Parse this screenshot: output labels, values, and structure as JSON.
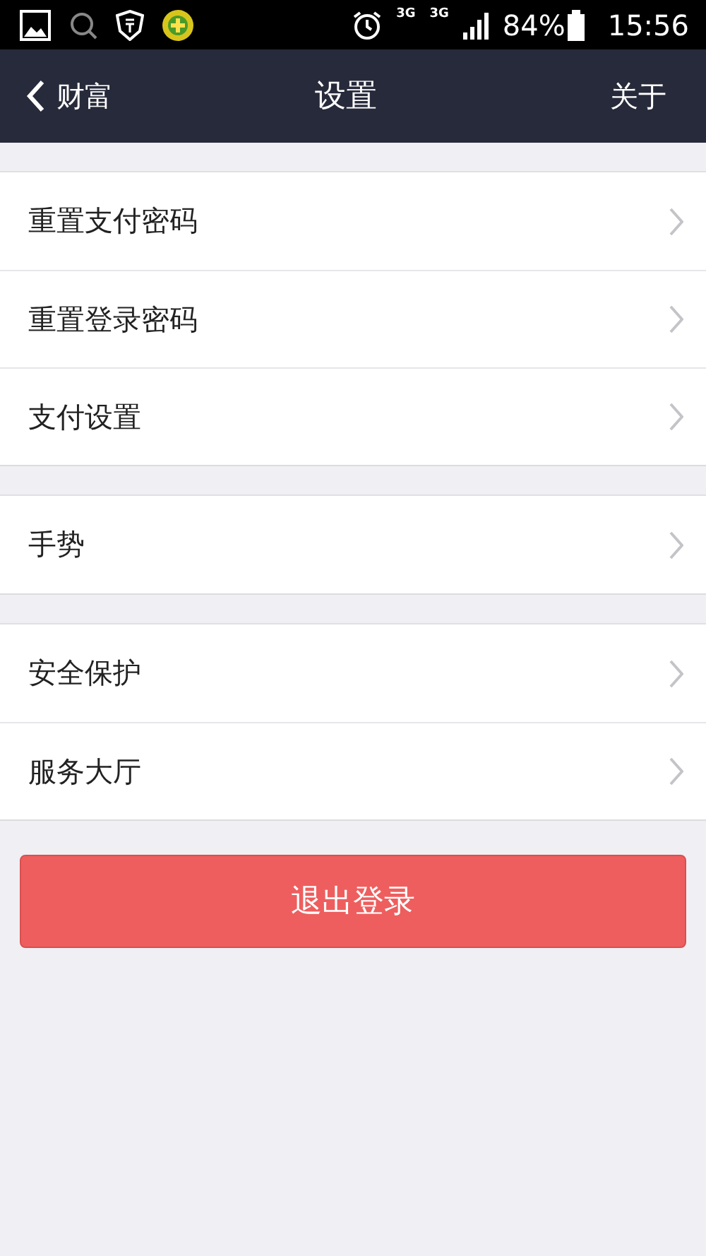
{
  "status_bar": {
    "network_labels": [
      "3G",
      "3G"
    ],
    "battery": "84%",
    "time": "15:56"
  },
  "nav_bar": {
    "back_label": "财富",
    "title": "设置",
    "action": "关于"
  },
  "groups": [
    {
      "items": [
        {
          "label": "重置支付密码"
        },
        {
          "label": "重置登录密码"
        },
        {
          "label": "支付设置"
        }
      ]
    },
    {
      "items": [
        {
          "label": "手势"
        }
      ]
    },
    {
      "items": [
        {
          "label": "安全保护"
        },
        {
          "label": "服务大厅"
        }
      ]
    }
  ],
  "logout_button": "退出登录"
}
